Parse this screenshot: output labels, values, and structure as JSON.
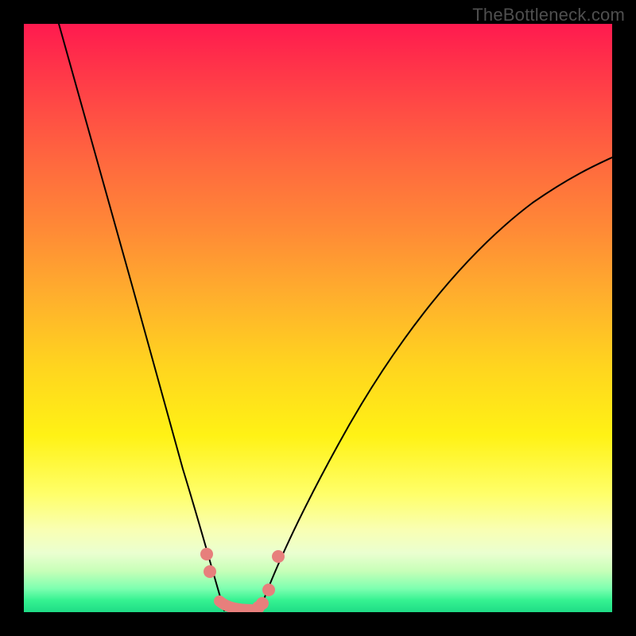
{
  "watermark": "TheBottleneck.com",
  "colors": {
    "frame": "#000000",
    "curve": "#000000",
    "dots": "#e77f7c",
    "gradient_stops": [
      "#ff1a4f",
      "#ff4a45",
      "#ff8a36",
      "#ffd41f",
      "#fff215",
      "#ffff6a",
      "#c7ffb8",
      "#1fdc86"
    ]
  },
  "chart_data": {
    "type": "line",
    "title": "",
    "xlabel": "",
    "ylabel": "",
    "xlim": [
      0,
      100
    ],
    "ylim": [
      0,
      100
    ],
    "series": [
      {
        "name": "left-curve",
        "x": [
          6,
          10,
          14,
          18,
          22,
          25,
          27,
          29,
          31,
          32.5,
          34
        ],
        "y": [
          100,
          85,
          70,
          55,
          40,
          28,
          20,
          14,
          8,
          4,
          0
        ]
      },
      {
        "name": "right-curve",
        "x": [
          40,
          42,
          45,
          49,
          54,
          60,
          67,
          75,
          84,
          93,
          100
        ],
        "y": [
          0,
          3,
          8,
          16,
          26,
          37,
          48,
          58,
          67,
          74,
          78
        ]
      },
      {
        "name": "trough-dots",
        "x": [
          31.5,
          32,
          33.5,
          35,
          37,
          38.5,
          40,
          40.5,
          42,
          43.5
        ],
        "y": [
          10,
          6.5,
          1.5,
          0.5,
          0.5,
          0.5,
          0.8,
          1.2,
          4,
          9.5
        ]
      }
    ],
    "annotations": []
  }
}
